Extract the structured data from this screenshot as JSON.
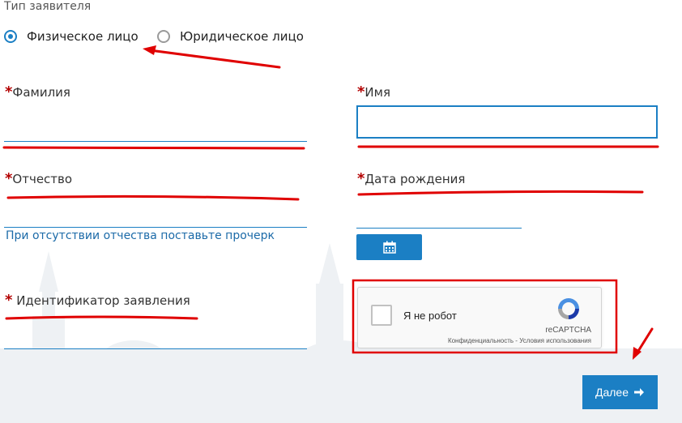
{
  "applicant_type": {
    "label": "Тип заявителя",
    "options": [
      {
        "label": "Физическое лицо",
        "selected": true
      },
      {
        "label": "Юридическое лицо",
        "selected": false
      }
    ]
  },
  "fields": {
    "surname": {
      "label": "Фамилия",
      "required_mark": "*",
      "value": ""
    },
    "name": {
      "label": "Имя",
      "required_mark": "*",
      "value": ""
    },
    "patronymic": {
      "label": "Отчество",
      "required_mark": "*",
      "value": "",
      "hint": "При отсутствии отчества поставьте прочерк"
    },
    "birth_date": {
      "label": "Дата рождения",
      "required_mark": "*",
      "value": "",
      "calendar_icon": "calendar-icon"
    },
    "application_id": {
      "label": "Идентификатор заявления",
      "required_mark": "*",
      "value": ""
    }
  },
  "recaptcha": {
    "checkbox_label": "Я не робот",
    "brand": "reCAPTCHA",
    "links": "Конфиденциальность - Условия использования"
  },
  "next_button": {
    "label": "Далее",
    "icon": "arrow-right-icon"
  },
  "colors": {
    "accent": "#1b7fc4",
    "required": "#b30000",
    "annotation": "#e00000"
  }
}
